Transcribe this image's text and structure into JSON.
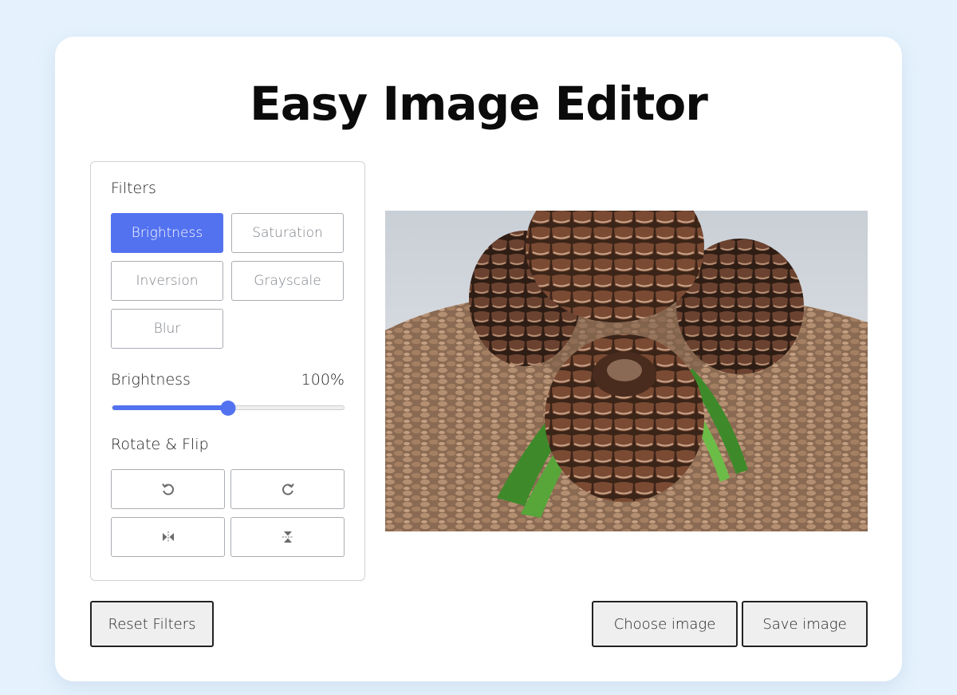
{
  "app": {
    "title": "Easy Image Editor"
  },
  "filters": {
    "heading": "Filters",
    "options": [
      {
        "label": "Brightness",
        "active": true
      },
      {
        "label": "Saturation",
        "active": false
      },
      {
        "label": "Inversion",
        "active": false
      },
      {
        "label": "Grayscale",
        "active": false
      },
      {
        "label": "Blur",
        "active": false
      }
    ],
    "active_name": "Brightness",
    "value_text": "100%",
    "slider_fraction": 0.5
  },
  "rotate": {
    "heading": "Rotate & Flip",
    "buttons": [
      {
        "icon": "rotate-left-icon"
      },
      {
        "icon": "rotate-right-icon"
      },
      {
        "icon": "flip-horizontal-icon"
      },
      {
        "icon": "flip-vertical-icon"
      }
    ]
  },
  "preview": {
    "subject": "pine-cones-photo"
  },
  "actions": {
    "reset_label": "Reset Filters",
    "choose_label": "Choose image",
    "save_label": "Save image"
  },
  "colors": {
    "accent": "#5372f0",
    "page_background": "#e5f2fd",
    "card_background": "#ffffff"
  }
}
